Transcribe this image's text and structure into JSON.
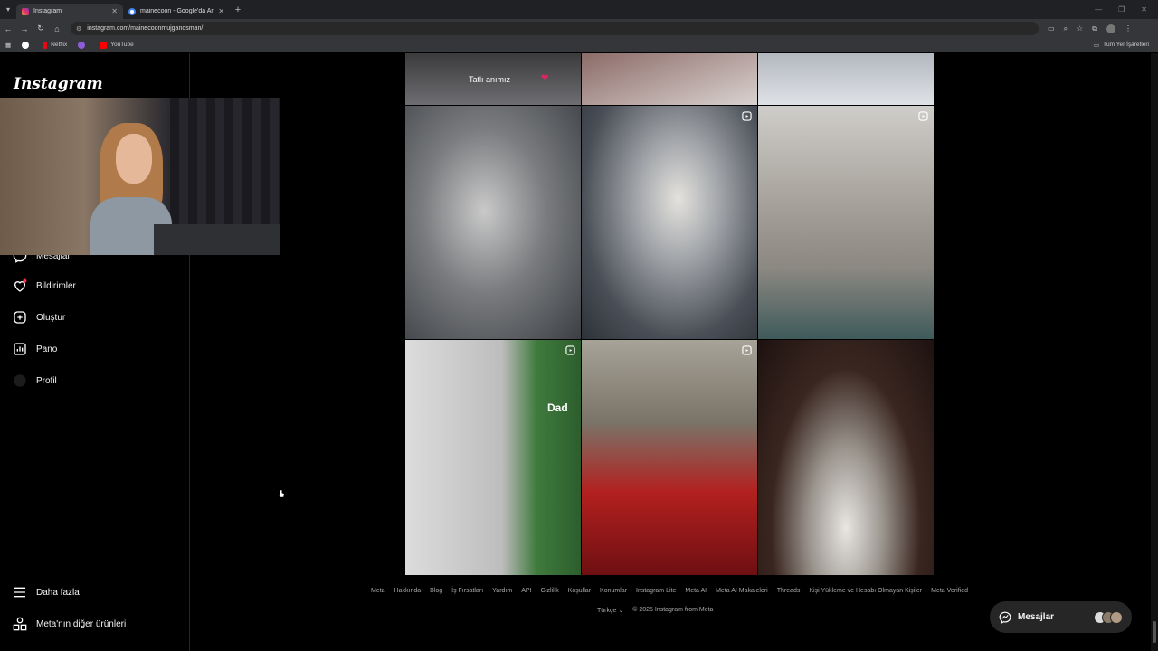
{
  "browser": {
    "tabs": [
      {
        "label": "Instagram",
        "active": true
      },
      {
        "label": "mainecoon - Google'da Ara",
        "active": false
      }
    ],
    "url": "instagram.com/mainecoonmujganosman/",
    "bookmarks": [
      "Netflix",
      "YouTube"
    ],
    "bookmarks_right": "Tüm Yer İşaretleri"
  },
  "instagram": {
    "logo": "Instagram",
    "nav": {
      "messages": "Mesajlar",
      "notifications": "Bildirimler",
      "create": "Oluştur",
      "dashboard": "Pano",
      "profile": "Profil",
      "more": "Daha fazla",
      "meta_products": "Meta'nın diğer ürünleri"
    },
    "posts": {
      "top_left_caption": "Tatlı anımız",
      "caption_dad": "Dad"
    },
    "footer": {
      "links": [
        "Meta",
        "Hakkında",
        "Blog",
        "İş Fırsatları",
        "Yardım",
        "API",
        "Gizlilik",
        "Koşullar",
        "Konumlar",
        "Instagram Lite",
        "Meta AI",
        "Meta AI Makaleleri",
        "Threads",
        "Kişi Yükleme ve Hesabı Olmayan Kişiler",
        "Meta Verified"
      ],
      "language": "Türkçe",
      "copyright": "© 2025 Instagram from Meta"
    },
    "messages_pill": "Mesajlar"
  },
  "colors": {
    "accent_heart": "#ff3040",
    "background": "#000000"
  }
}
